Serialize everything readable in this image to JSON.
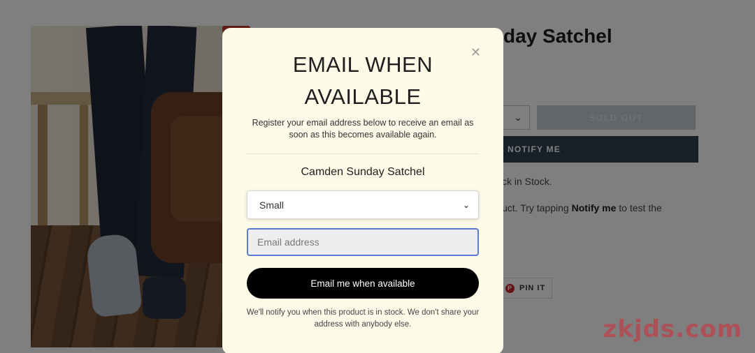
{
  "background": {
    "product_title": "day Satchel",
    "sold_out_label": "SOLD OUT",
    "notify_label": "NOTIFY ME",
    "stock_text": "ck in Stock.",
    "hint_prefix": "uct. Try tapping ",
    "hint_bold": "Notify me",
    "hint_suffix": " to test the",
    "pin_label": "PIN IT"
  },
  "modal": {
    "title_line1": "EMAIL WHEN",
    "title_line2": "AVAILABLE",
    "description": "Register your email address below to receive an email as soon as this becomes available again.",
    "product_name": "Camden Sunday Satchel",
    "variant_selected": "Small",
    "email_placeholder": "Email address",
    "submit_label": "Email me when available",
    "footnote": "We'll notify you when this product is in stock. We don't share your address with anybody else."
  },
  "watermark": "zkjds.com",
  "colors": {
    "modal_bg": "#fdfbe8",
    "submit_bg": "#000000",
    "notify_bg": "#2f3f53",
    "input_focus": "#5b7bd6"
  }
}
